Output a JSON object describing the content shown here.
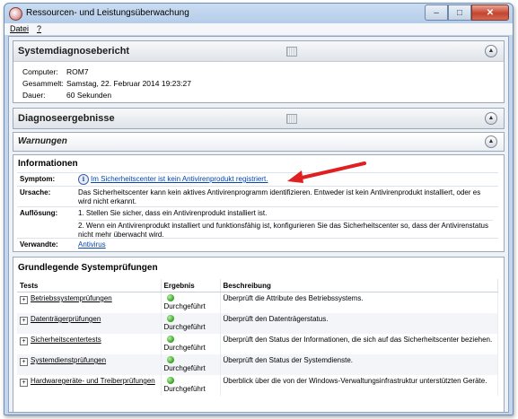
{
  "window": {
    "title": "Ressourcen- und Leistungsüberwachung",
    "controls": {
      "minimize": "–",
      "maximize": "□",
      "close": "✕"
    }
  },
  "menu": {
    "items": [
      "Datei",
      "?"
    ]
  },
  "report": {
    "title": "Systemdiagnosebericht",
    "fields": [
      {
        "label": "Computer:",
        "value": "ROM7"
      },
      {
        "label": "Gesammelt:",
        "value": "Samstag, 22. Februar 2014 19:23:27"
      },
      {
        "label": "Dauer:",
        "value": "60 Sekunden"
      }
    ]
  },
  "results": {
    "title": "Diagnoseergebnisse"
  },
  "warnings": {
    "title": "Warnungen"
  },
  "information": {
    "title": "Informationen",
    "symptom_label": "Symptom:",
    "symptom_value": "Im Sicherheitscenter ist kein Antivirenprodukt registriert.",
    "cause_label": "Ursache:",
    "cause_value": "Das Sicherheitscenter kann kein aktives Antivirenprogramm identifizieren. Entweder ist kein Antivirenprodukt installiert, oder es wird nicht erkannt.",
    "resolution_label": "Auflösung:",
    "resolution_1": "1. Stellen Sie sicher, dass ein Antivirenprodukt installiert ist.",
    "resolution_2": "2. Wenn ein Antivirenprodukt installiert und funktionsfähig ist, konfigurieren Sie das Sicherheitscenter so, dass der Antivirenstatus nicht mehr überwacht wird.",
    "related_label": "Verwandte:",
    "related_value": "Antivirus"
  },
  "checks": {
    "title": "Grundlegende Systemprüfungen",
    "columns": [
      "Tests",
      "Ergebnis",
      "Beschreibung"
    ],
    "rows": [
      {
        "test": "Betriebssystemprüfungen",
        "result": "Durchgeführt",
        "description": "Überprüft die Attribute des Betriebssystems."
      },
      {
        "test": "Datenträgerprüfungen",
        "result": "Durchgeführt",
        "description": "Überprüft den Datenträgerstatus."
      },
      {
        "test": "Sicherheitscentertests",
        "result": "Durchgeführt",
        "description": "Überprüft den Status der Informationen, die sich auf das Sicherheitscenter beziehen."
      },
      {
        "test": "Systemdienstprüfungen",
        "result": "Durchgeführt",
        "description": "Überprüft den Status der Systemdienste."
      },
      {
        "test": "Hardwaregeräte- und Treiberprüfungen",
        "result": "Durchgeführt",
        "description": "Überblick über die von der Windows-Verwaltungsinfrastruktur unterstützten Geräte."
      }
    ]
  },
  "colors": {
    "annotation_arrow": "#e02020",
    "link": "#0645ad",
    "ok": "#3da52c"
  }
}
